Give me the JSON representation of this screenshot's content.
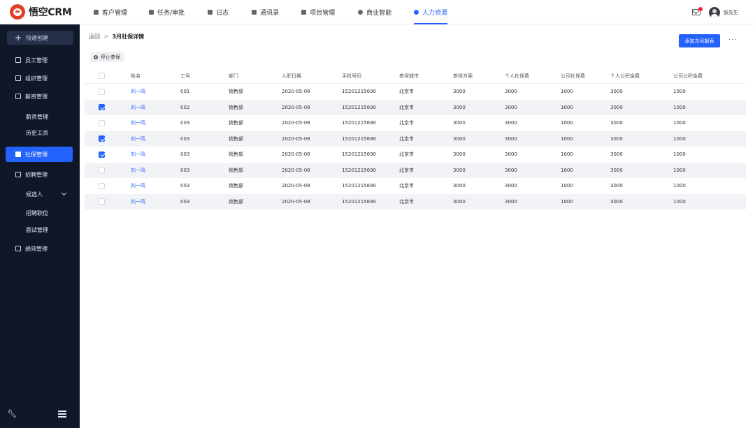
{
  "app": {
    "logo_text": "悟空CRM"
  },
  "topnav": {
    "items": [
      {
        "label": "客户管理",
        "icon": "customer-icon"
      },
      {
        "label": "任务/审批",
        "icon": "briefcase-icon"
      },
      {
        "label": "日志",
        "icon": "log-icon"
      },
      {
        "label": "通讯录",
        "icon": "contacts-icon"
      },
      {
        "label": "项目管理",
        "icon": "project-icon"
      },
      {
        "label": "商业智能",
        "icon": "bi-icon"
      },
      {
        "label": "人力资源",
        "icon": "person-icon",
        "active": true
      }
    ],
    "user_name": "张先生",
    "accent": "#2362fb"
  },
  "sidebar": {
    "quick_create": "快速创建",
    "items": [
      {
        "label": "员工管理"
      },
      {
        "label": "组织管理"
      },
      {
        "label": "薪资管理"
      },
      {
        "label": "薪资管理"
      },
      {
        "label": "历史工资"
      },
      {
        "label": "社保管理",
        "active": true
      },
      {
        "label": "招聘管理"
      },
      {
        "label": "候选人"
      },
      {
        "label": "招聘职位"
      },
      {
        "label": "面试管理"
      },
      {
        "label": "绩效管理"
      }
    ]
  },
  "page": {
    "breadcrumb_back": "返回",
    "breadcrumb_sep": ">",
    "title": "3月社保详情",
    "add_report_button": "添加次月报表",
    "stop_button": "停止参保",
    "more": "···"
  },
  "table": {
    "headers": [
      "姓名",
      "工号",
      "部门",
      "入职日期",
      "手机号码",
      "参保城市",
      "参保方案",
      "个人社保费",
      "公司社保费",
      "个人公积金费",
      "公司公积金费"
    ],
    "rows": [
      {
        "checked": false,
        "cells": [
          "刘一鸣",
          "001",
          "销售部",
          "2020-05-08",
          "15201215690",
          "北京市",
          "3000",
          "3000",
          "1000",
          "3000",
          "1000"
        ]
      },
      {
        "checked": true,
        "cells": [
          "刘一鸣",
          "002",
          "销售部",
          "2020-05-08",
          "15201215690",
          "北京市",
          "3000",
          "3000",
          "1000",
          "3000",
          "1000"
        ]
      },
      {
        "checked": false,
        "cells": [
          "刘一鸣",
          "003",
          "销售部",
          "2020-05-08",
          "15201215690",
          "北京市",
          "3000",
          "3000",
          "1000",
          "3000",
          "1000"
        ]
      },
      {
        "checked": true,
        "cells": [
          "刘一鸣",
          "003",
          "销售部",
          "2020-05-08",
          "15201215690",
          "北京市",
          "3000",
          "3000",
          "1000",
          "3000",
          "1000"
        ]
      },
      {
        "checked": true,
        "cells": [
          "刘一鸣",
          "003",
          "销售部",
          "2020-05-08",
          "15201215690",
          "北京市",
          "3000",
          "3000",
          "1000",
          "3000",
          "1000"
        ]
      },
      {
        "checked": false,
        "cells": [
          "刘一鸣",
          "003",
          "销售部",
          "2020-05-08",
          "15201215690",
          "北京市",
          "3000",
          "3000",
          "1000",
          "3000",
          "1000"
        ]
      },
      {
        "checked": false,
        "cells": [
          "刘一鸣",
          "003",
          "销售部",
          "2020-05-08",
          "15201215690",
          "北京市",
          "3000",
          "3000",
          "1000",
          "3000",
          "1000"
        ]
      },
      {
        "checked": false,
        "cells": [
          "刘一鸣",
          "003",
          "销售部",
          "2020-05-08",
          "15201215690",
          "北京市",
          "3000",
          "3000",
          "1000",
          "3000",
          "1000"
        ]
      }
    ]
  }
}
